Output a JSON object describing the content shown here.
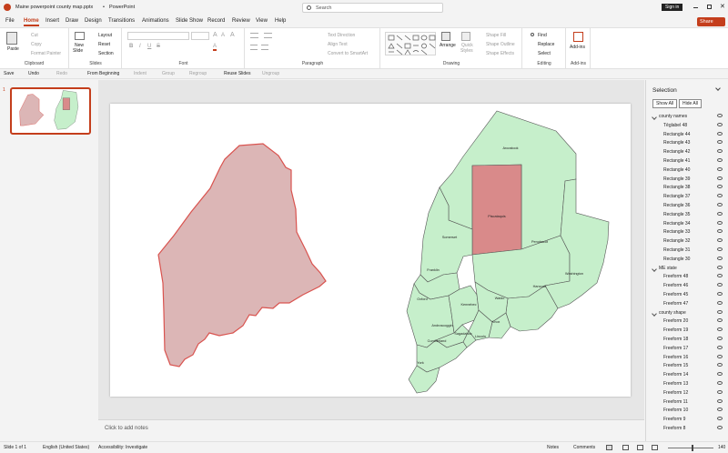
{
  "titlebar": {
    "file_name": "Maine powerpoint county map.pptx",
    "separator": "•",
    "app_name": "PowerPoint",
    "search_placeholder": "Search",
    "sign_in": "Sign in"
  },
  "menu": {
    "tabs": [
      "File",
      "Home",
      "Insert",
      "Draw",
      "Design",
      "Transitions",
      "Animations",
      "Slide Show",
      "Record",
      "Review",
      "View",
      "Help"
    ],
    "share_label": "Share"
  },
  "ribbon": {
    "clipboard": {
      "paste": "Paste",
      "cut": "Cut",
      "copy": "Copy",
      "format_painter": "Format Painter",
      "label": "Clipboard"
    },
    "slides": {
      "new_slide": "New",
      "new_slide2": "Slide",
      "layout": "Layout",
      "reset": "Reset",
      "section": "Section",
      "label": "Slides"
    },
    "font": {
      "label": "Font"
    },
    "paragraph": {
      "text_direction": "Text Direction",
      "align_text": "Align Text",
      "convert_smartart": "Convert to SmartArt",
      "label": "Paragraph"
    },
    "drawing": {
      "arrange": "Arrange",
      "quick_styles": "Quick",
      "quick_styles2": "Styles",
      "shape_fill": "Shape Fill",
      "shape_outline": "Shape Outline",
      "shape_effects": "Shape Effects",
      "label": "Drawing"
    },
    "editing": {
      "find": "Find",
      "replace": "Replace",
      "select": "Select",
      "label": "Editing"
    },
    "addins": {
      "addins": "Add-ins",
      "label": "Add-ins"
    }
  },
  "qat": {
    "save": "Save",
    "undo": "Undo",
    "redo": "Redo",
    "from_beginning": "From Beginning",
    "indent": "Indent",
    "group": "Group",
    "regroup": "Regroup",
    "reuse_slides": "Reuse Slides",
    "ungroup": "Ungroup"
  },
  "thumbnails": {
    "slide_number": "1"
  },
  "slide": {
    "counties": [
      "Aroostook",
      "Piscataquis",
      "Somerset",
      "Penobscot",
      "Franklin",
      "Washington",
      "Hancock",
      "Oxford",
      "Waldo",
      "Kennebec",
      "Androscoggin",
      "Knox",
      "Lincoln",
      "Sagadahoc",
      "Cumberland",
      "York"
    ]
  },
  "notes": {
    "placeholder": "Click to add notes"
  },
  "selection_pane": {
    "title": "Selection",
    "show_all": "Show All",
    "hide_all": "Hide All",
    "groups": [
      {
        "name": "county names",
        "items": [
          "Tēglabel 48",
          "Rectangle 44",
          "Rectangle 43",
          "Rectangle 42",
          "Rectangle 41",
          "Rectangle 40",
          "Rectangle 39",
          "Rectangle 38",
          "Rectangle 37",
          "Rectangle 36",
          "Rectangle 35",
          "Rectangle 34",
          "Rectangle 33",
          "Rectangle 32",
          "Rectangle 31",
          "Rectangle 30"
        ]
      },
      {
        "name": "ME state",
        "items": [
          "Freeform 48",
          "Freeform 46",
          "Freeform 45",
          "Freeform 47"
        ]
      },
      {
        "name": "county shape",
        "items": [
          "Freeform 20",
          "Freeform 19",
          "Freeform 18",
          "Freeform 17",
          "Freeform 16",
          "Freeform 15",
          "Freeform 14",
          "Freeform 13",
          "Freeform 12",
          "Freeform 11",
          "Freeform 10",
          "Freeform 9",
          "Freeform 8"
        ]
      }
    ]
  },
  "status": {
    "slide_of": "Slide 1 of 1",
    "language": "English (United States)",
    "accessibility": "Accessibility: Investigate",
    "notes": "Notes",
    "comments": "Comments",
    "zoom": "140"
  },
  "colors": {
    "accent": "#c43e1c",
    "county_fill": "#c6efcb",
    "highlight_fill": "#d98a8a",
    "state_fill": "#dcb6b6",
    "state_stroke": "#d9534f"
  }
}
